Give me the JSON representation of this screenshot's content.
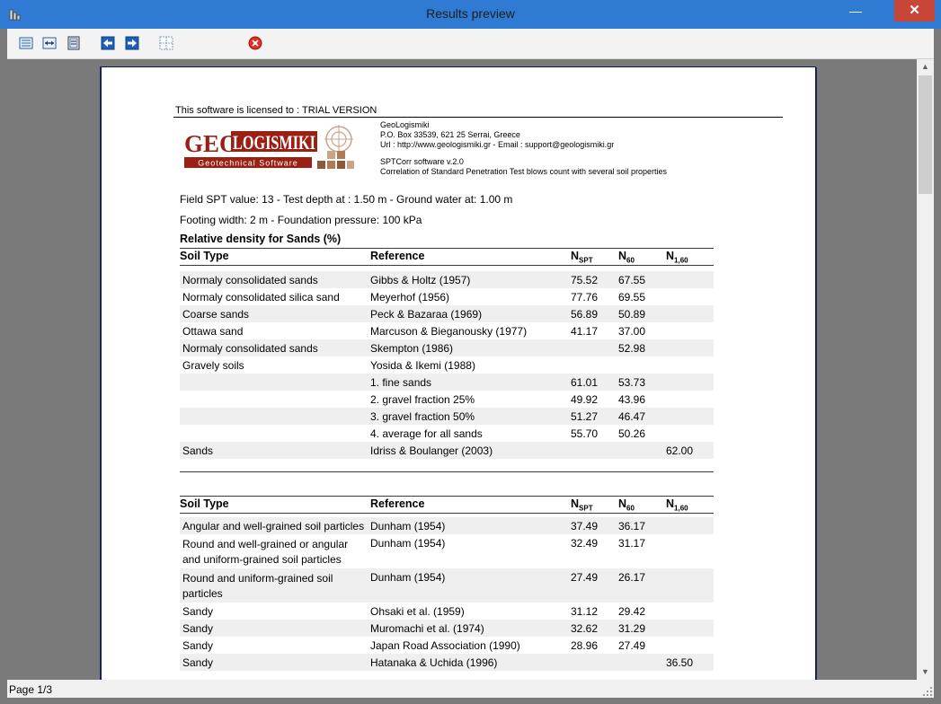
{
  "window": {
    "title": "Results preview",
    "minimize": "—",
    "close": "✕"
  },
  "toolbar": {
    "buttons": [
      "page-layout",
      "fit-width",
      "full-page",
      "previous-page",
      "next-page",
      "grid",
      "close-preview"
    ]
  },
  "page": {
    "license": "This software is licensed to : TRIAL VERSION",
    "company": {
      "name": "GeoLogismiki",
      "address": "P.O. Box 33539, 621 25 Serrai, Greece",
      "contact": "Url : http://www.geologismiki.gr - Email : support@geologismiki.gr"
    },
    "software": {
      "name": "SPTCorr software v.2.0",
      "description": "Correlation of Standard Penetration Test blows count with several soil properties"
    },
    "logo": {
      "text_top_1": "GEO",
      "text_top_2": "LOGISMIKI",
      "text_bottom": "Geotechnical Software"
    },
    "field_info": "Field SPT value: 13 - Test depth at : 1.50 m - Ground water at: 1.00 m",
    "footing_info": "Footing width: 2 m - Foundation pressure: 100 kPa",
    "section1_title": "Relative density for Sands (%)",
    "headers": {
      "soil_type": "Soil Type",
      "reference": "Reference",
      "nspt": "N",
      "nspt_sub": "SPT",
      "n60": "N",
      "n60_sub": "60",
      "n160": "N",
      "n160_sub": "1,60"
    },
    "table1": [
      {
        "soil": "Normaly consolidated sands",
        "ref": "Gibbs & Holtz (1957)",
        "nspt": "75.52",
        "n60": "67.55",
        "n160": ""
      },
      {
        "soil": "Normaly consolidated silica sand",
        "ref": "Meyerhof (1956)",
        "nspt": "77.76",
        "n60": "69.55",
        "n160": ""
      },
      {
        "soil": "Coarse sands",
        "ref": "Peck & Bazaraa (1969)",
        "nspt": "56.89",
        "n60": "50.89",
        "n160": ""
      },
      {
        "soil": "Ottawa sand",
        "ref": "Marcuson & Bieganousky (1977)",
        "nspt": "41.17",
        "n60": "37.00",
        "n160": ""
      },
      {
        "soil": "Normaly consolidated sands",
        "ref": "Skempton (1986)",
        "nspt": "",
        "n60": "52.98",
        "n160": ""
      },
      {
        "soil": "Gravely soils",
        "ref": "Yosida & Ikemi (1988)",
        "nspt": "",
        "n60": "",
        "n160": ""
      },
      {
        "soil": "",
        "ref": " 1. fine sands",
        "nspt": "61.01",
        "n60": "53.73",
        "n160": ""
      },
      {
        "soil": "",
        "ref": " 2. gravel fraction 25%",
        "nspt": "49.92",
        "n60": "43.96",
        "n160": ""
      },
      {
        "soil": "",
        "ref": " 3. gravel fraction 50%",
        "nspt": "51.27",
        "n60": "46.47",
        "n160": ""
      },
      {
        "soil": "",
        "ref": " 4. average for all sands",
        "nspt": "55.70",
        "n60": "50.26",
        "n160": ""
      },
      {
        "soil": "Sands",
        "ref": "Idriss & Boulanger (2003)",
        "nspt": "",
        "n60": "",
        "n160": "62.00"
      }
    ],
    "table2": [
      {
        "soil": "Angular and well-grained soil particles",
        "ref": "Dunham (1954)",
        "nspt": "37.49",
        "n60": "36.17",
        "n160": ""
      },
      {
        "soil": "Round and well-grained or angular and uniform-grained soil particles",
        "ref": "Dunham (1954)",
        "nspt": "32.49",
        "n60": "31.17",
        "n160": ""
      },
      {
        "soil": "Round and uniform-grained soil particles",
        "ref": "Dunham (1954)",
        "nspt": "27.49",
        "n60": "26.17",
        "n160": ""
      },
      {
        "soil": "Sandy",
        "ref": "Ohsaki et al. (1959)",
        "nspt": "31.12",
        "n60": "29.42",
        "n160": ""
      },
      {
        "soil": "Sandy",
        "ref": "Muromachi et al. (1974)",
        "nspt": "32.62",
        "n60": "31.29",
        "n160": ""
      },
      {
        "soil": "Sandy",
        "ref": "Japan Road Association (1990)",
        "nspt": "28.96",
        "n60": "27.49",
        "n160": ""
      },
      {
        "soil": "Sandy",
        "ref": "Hatanaka & Uchida (1996)",
        "nspt": "",
        "n60": "",
        "n160": "36.50"
      }
    ]
  },
  "status": {
    "page": "Page 1/3"
  },
  "colors": {
    "title_bar": "#2f7ad3",
    "close_button": "#c74638",
    "preview_background": "#7a7a7a",
    "row_shading": "#efefef",
    "logo_red": "#9b1f13",
    "logo_brown": "#8a5a3a"
  }
}
